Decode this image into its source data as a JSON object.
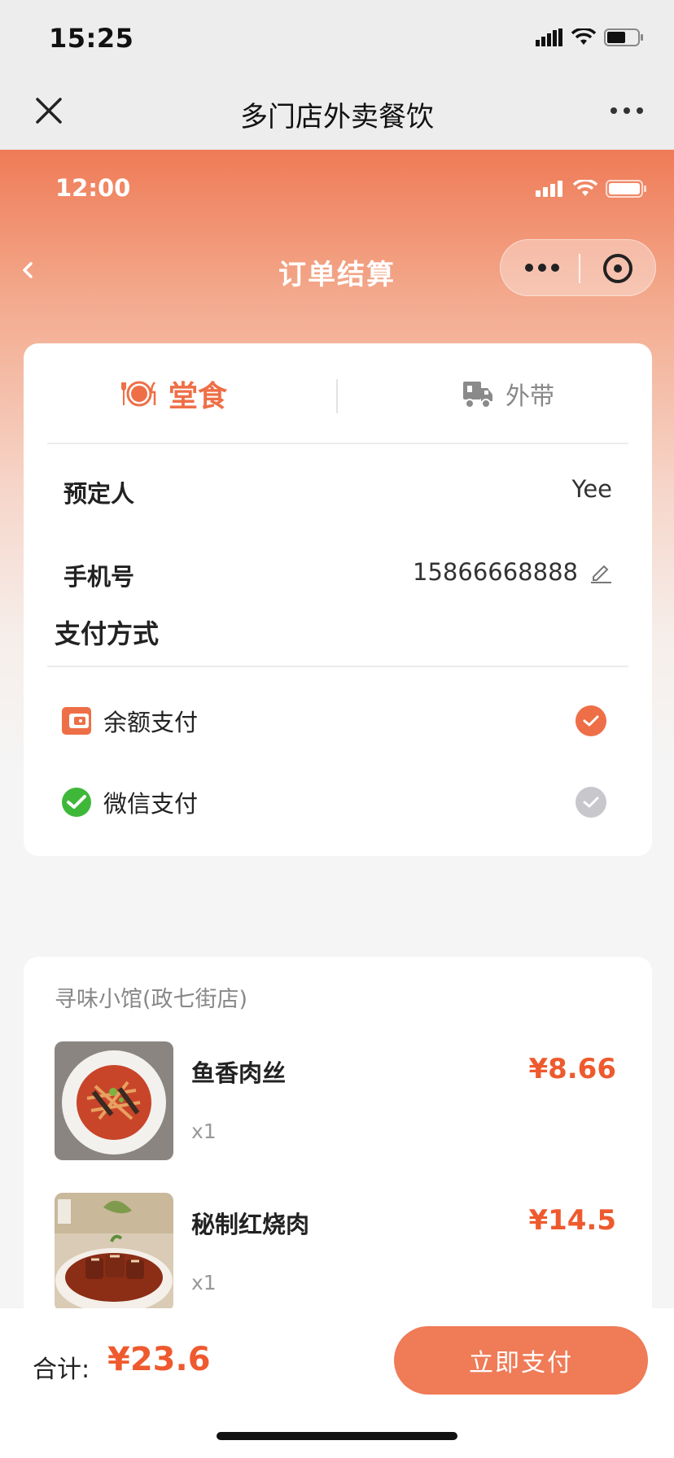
{
  "outer": {
    "time": "15:25",
    "title": "多门店外卖餐饮"
  },
  "inner": {
    "time": "12:00",
    "title": "订单结算"
  },
  "order": {
    "tabs": [
      {
        "label": "堂食",
        "icon": "dine-in-icon",
        "active": true
      },
      {
        "label": "外带",
        "icon": "delivery-truck-icon",
        "active": false
      }
    ],
    "reserver_label": "预定人",
    "reserver_value": "Yee",
    "phone_label": "手机号",
    "phone_value": "15866668888"
  },
  "payment": {
    "title": "支付方式",
    "options": [
      {
        "label": "余额支付",
        "icon": "wallet-icon",
        "selected": true
      },
      {
        "label": "微信支付",
        "icon": "wechat-pay-icon",
        "selected": false
      }
    ]
  },
  "items": {
    "shop": "寻味小馆(政七街店)",
    "list": [
      {
        "name": "鱼香肉丝",
        "qty": "x1",
        "price": "¥8.66"
      },
      {
        "name": "秘制红烧肉",
        "qty": "x1",
        "price": "¥14.5"
      }
    ]
  },
  "footer": {
    "total_label": "合计:",
    "total_value": "¥23.6",
    "pay_button": "立即支付"
  },
  "colors": {
    "accent": "#ee6f47",
    "price": "#ee5a2e",
    "wechat_green": "#3fb83a"
  }
}
